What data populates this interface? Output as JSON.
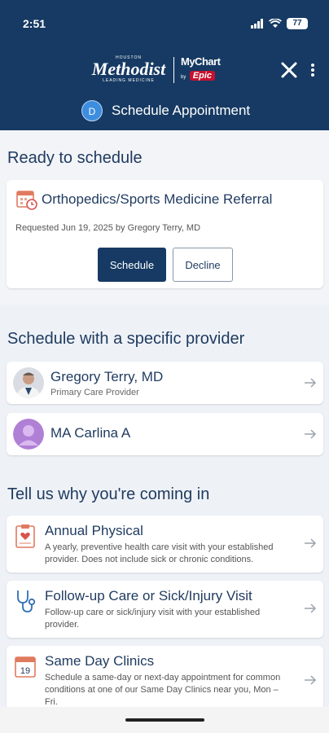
{
  "status_bar": {
    "time": "2:51",
    "battery": "77"
  },
  "header": {
    "logo_org_small_top": "HOUSTON",
    "logo_org_name": "Methodist",
    "logo_org_tagline": "LEADING MEDICINE",
    "logo_app": "MyChart",
    "logo_app_by": "by",
    "logo_epic": "Epic",
    "avatar_initial": "D",
    "title": "Schedule Appointment"
  },
  "ready": {
    "heading": "Ready to schedule",
    "referral_title": "Orthopedics/Sports Medicine Referral",
    "referral_sub": "Requested Jun 19, 2025 by Gregory Terry, MD",
    "schedule_label": "Schedule",
    "decline_label": "Decline"
  },
  "providers": {
    "heading": "Schedule with a specific provider",
    "items": [
      {
        "name": "Gregory Terry, MD",
        "role": "Primary Care Provider"
      },
      {
        "name": "MA Carlina A",
        "role": ""
      }
    ]
  },
  "reasons": {
    "heading": "Tell us why you're coming in",
    "items": [
      {
        "title": "Annual Physical",
        "desc": "A yearly, preventive health care visit with your established provider. Does not include sick or chronic conditions.",
        "icon": "clipboard-heart-icon"
      },
      {
        "title": "Follow-up Care or Sick/Injury Visit",
        "desc": "Follow-up care or sick/injury visit with your established provider.",
        "icon": "stethoscope-icon"
      },
      {
        "title": "Same Day Clinics",
        "desc": "Schedule a same-day or next-day appointment for common conditions at one of our Same Day Clinics near you, Mon – Fri.",
        "icon": "calendar-19-icon",
        "calendar_day": "19"
      }
    ]
  }
}
